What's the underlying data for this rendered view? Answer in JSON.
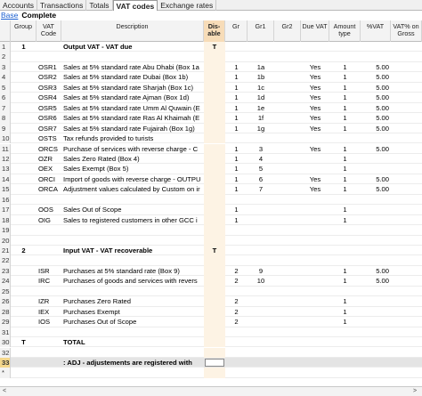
{
  "tabs": [
    "Accounts",
    "Transactions",
    "Totals",
    "VAT codes",
    "Exchange rates"
  ],
  "active_tab": 3,
  "views": [
    "Base",
    "Complete"
  ],
  "columns": [
    "",
    "Group",
    "VAT Code",
    "Description",
    "Dis-able",
    "Gr",
    "Gr1",
    "Gr2",
    "Due VAT",
    "Amount type",
    "%VAT",
    "VAT% on Gross"
  ],
  "rows": [
    {
      "n": "1",
      "group": "1",
      "code": "",
      "desc": "Output VAT -  VAT due",
      "dis": "T",
      "gr": "",
      "gr1": "",
      "gr2": "",
      "due": "",
      "amt": "",
      "pct": "",
      "bold": true
    },
    {
      "n": "2",
      "group": "",
      "code": "",
      "desc": "",
      "dis": "",
      "gr": "",
      "gr1": "",
      "gr2": "",
      "due": "",
      "amt": "",
      "pct": ""
    },
    {
      "n": "3",
      "group": "",
      "code": "OSR1",
      "desc": "Sales at 5% standard rate Abu Dhabi (Box 1a",
      "dis": "",
      "gr": "1",
      "gr1": "1a",
      "gr2": "",
      "due": "Yes",
      "amt": "1",
      "pct": "5.00"
    },
    {
      "n": "4",
      "group": "",
      "code": "OSR2",
      "desc": "Sales at 5% standard rate Dubai (Box 1b)",
      "dis": "",
      "gr": "1",
      "gr1": "1b",
      "gr2": "",
      "due": "Yes",
      "amt": "1",
      "pct": "5.00"
    },
    {
      "n": "5",
      "group": "",
      "code": "OSR3",
      "desc": "Sales at 5% standard rate Sharjah (Box 1c)",
      "dis": "",
      "gr": "1",
      "gr1": "1c",
      "gr2": "",
      "due": "Yes",
      "amt": "1",
      "pct": "5.00"
    },
    {
      "n": "6",
      "group": "",
      "code": "OSR4",
      "desc": "Sales at 5% standard rate Ajman (Box 1d)",
      "dis": "",
      "gr": "1",
      "gr1": "1d",
      "gr2": "",
      "due": "Yes",
      "amt": "1",
      "pct": "5.00"
    },
    {
      "n": "7",
      "group": "",
      "code": "OSR5",
      "desc": "Sales at 5% standard rate Umm Al Quwain (E",
      "dis": "",
      "gr": "1",
      "gr1": "1e",
      "gr2": "",
      "due": "Yes",
      "amt": "1",
      "pct": "5.00"
    },
    {
      "n": "8",
      "group": "",
      "code": "OSR6",
      "desc": "Sales at 5% standard rate Ras Al Khaimah (E",
      "dis": "",
      "gr": "1",
      "gr1": "1f",
      "gr2": "",
      "due": "Yes",
      "amt": "1",
      "pct": "5.00"
    },
    {
      "n": "9",
      "group": "",
      "code": "OSR7",
      "desc": "Sales at 5% standard rate Fujairah (Box 1g)",
      "dis": "",
      "gr": "1",
      "gr1": "1g",
      "gr2": "",
      "due": "Yes",
      "amt": "1",
      "pct": "5.00"
    },
    {
      "n": "10",
      "group": "",
      "code": "OSTS",
      "desc": "Tax refunds provided to turists",
      "dis": "",
      "gr": "",
      "gr1": "",
      "gr2": "",
      "due": "",
      "amt": "",
      "pct": ""
    },
    {
      "n": "11",
      "group": "",
      "code": "ORCS",
      "desc": "Purchase of services with reverse charge - C",
      "dis": "",
      "gr": "1",
      "gr1": "3",
      "gr2": "",
      "due": "Yes",
      "amt": "1",
      "pct": "5.00"
    },
    {
      "n": "12",
      "group": "",
      "code": "OZR",
      "desc": "Sales Zero Rated (Box 4)",
      "dis": "",
      "gr": "1",
      "gr1": "4",
      "gr2": "",
      "due": "",
      "amt": "1",
      "pct": ""
    },
    {
      "n": "13",
      "group": "",
      "code": "OEX",
      "desc": "Sales Exempt (Box 5)",
      "dis": "",
      "gr": "1",
      "gr1": "5",
      "gr2": "",
      "due": "",
      "amt": "1",
      "pct": ""
    },
    {
      "n": "14",
      "group": "",
      "code": "ORCI",
      "desc": "Import of goods with reverse charge - OUTPU",
      "dis": "",
      "gr": "1",
      "gr1": "6",
      "gr2": "",
      "due": "Yes",
      "amt": "1",
      "pct": "5.00"
    },
    {
      "n": "15",
      "group": "",
      "code": "ORCA",
      "desc": "Adjustment values calculated by Custom on ir",
      "dis": "",
      "gr": "1",
      "gr1": "7",
      "gr2": "",
      "due": "Yes",
      "amt": "1",
      "pct": "5.00"
    },
    {
      "n": "16",
      "group": "",
      "code": "",
      "desc": "",
      "dis": "",
      "gr": "",
      "gr1": "",
      "gr2": "",
      "due": "",
      "amt": "",
      "pct": ""
    },
    {
      "n": "17",
      "group": "",
      "code": "OOS",
      "desc": "Sales Out of Scope",
      "dis": "",
      "gr": "1",
      "gr1": "",
      "gr2": "",
      "due": "",
      "amt": "1",
      "pct": ""
    },
    {
      "n": "18",
      "group": "",
      "code": "OIG",
      "desc": "Sales to registered customers in other GCC i",
      "dis": "",
      "gr": "1",
      "gr1": "",
      "gr2": "",
      "due": "",
      "amt": "1",
      "pct": ""
    },
    {
      "n": "19",
      "group": "",
      "code": "",
      "desc": "",
      "dis": "",
      "gr": "",
      "gr1": "",
      "gr2": "",
      "due": "",
      "amt": "",
      "pct": ""
    },
    {
      "n": "20",
      "group": "",
      "code": "",
      "desc": "",
      "dis": "",
      "gr": "",
      "gr1": "",
      "gr2": "",
      "due": "",
      "amt": "",
      "pct": ""
    },
    {
      "n": "21",
      "group": "2",
      "code": "",
      "desc": "Input VAT - VAT recoverable",
      "dis": "T",
      "gr": "",
      "gr1": "",
      "gr2": "",
      "due": "",
      "amt": "",
      "pct": "",
      "bold": true
    },
    {
      "n": "22",
      "group": "",
      "code": "",
      "desc": "",
      "dis": "",
      "gr": "",
      "gr1": "",
      "gr2": "",
      "due": "",
      "amt": "",
      "pct": ""
    },
    {
      "n": "23",
      "group": "",
      "code": "ISR",
      "desc": "Purchases at 5% standard rate (Box 9)",
      "dis": "",
      "gr": "2",
      "gr1": "9",
      "gr2": "",
      "due": "",
      "amt": "1",
      "pct": "5.00"
    },
    {
      "n": "24",
      "group": "",
      "code": "IRC",
      "desc": "Purchases of goods and services with revers",
      "dis": "",
      "gr": "2",
      "gr1": "10",
      "gr2": "",
      "due": "",
      "amt": "1",
      "pct": "5.00"
    },
    {
      "n": "25",
      "group": "",
      "code": "",
      "desc": "",
      "dis": "",
      "gr": "",
      "gr1": "",
      "gr2": "",
      "due": "",
      "amt": "",
      "pct": ""
    },
    {
      "n": "26",
      "group": "",
      "code": "IZR",
      "desc": "Purchases Zero Rated",
      "dis": "",
      "gr": "2",
      "gr1": "",
      "gr2": "",
      "due": "",
      "amt": "1",
      "pct": ""
    },
    {
      "n": "28",
      "group": "",
      "code": "IEX",
      "desc": "Purchases Exempt",
      "dis": "",
      "gr": "2",
      "gr1": "",
      "gr2": "",
      "due": "",
      "amt": "1",
      "pct": ""
    },
    {
      "n": "29",
      "group": "",
      "code": "IOS",
      "desc": "Purchases Out of Scope",
      "dis": "",
      "gr": "2",
      "gr1": "",
      "gr2": "",
      "due": "",
      "amt": "1",
      "pct": ""
    },
    {
      "n": "31",
      "group": "",
      "code": "",
      "desc": "",
      "dis": "",
      "gr": "",
      "gr1": "",
      "gr2": "",
      "due": "",
      "amt": "",
      "pct": ""
    },
    {
      "n": "30",
      "group": "T",
      "code": "",
      "desc": "TOTAL",
      "dis": "",
      "gr": "",
      "gr1": "",
      "gr2": "",
      "due": "",
      "amt": "",
      "pct": "",
      "bold": true
    },
    {
      "n": "32",
      "group": "",
      "code": "",
      "desc": "",
      "dis": "",
      "gr": "",
      "gr1": "",
      "gr2": "",
      "due": "",
      "amt": "",
      "pct": ""
    },
    {
      "n": "33",
      "group": "",
      "code": "",
      "desc": ": ADJ - adjustements are registered with",
      "dis": "",
      "gr": "",
      "gr1": "",
      "gr2": "",
      "due": "",
      "amt": "",
      "pct": "",
      "bold": true,
      "active": true
    },
    {
      "n": "*",
      "group": "",
      "code": "",
      "desc": "",
      "dis": "",
      "gr": "",
      "gr1": "",
      "gr2": "",
      "due": "",
      "amt": "",
      "pct": ""
    }
  ]
}
